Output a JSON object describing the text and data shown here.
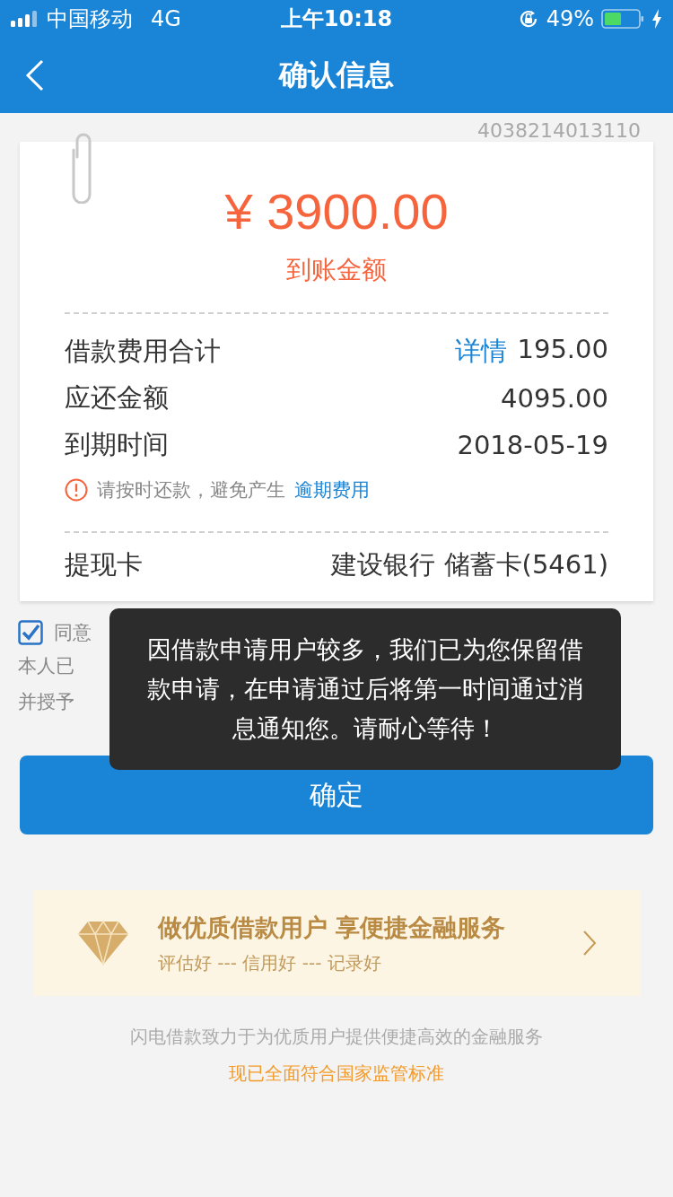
{
  "status_bar": {
    "carrier": "中国移动",
    "network": "4G",
    "time": "上午10:18",
    "battery": "49%"
  },
  "nav": {
    "title": "确认信息"
  },
  "card": {
    "serial": "4038214013110",
    "amount": "¥ 3900.00",
    "amount_label": "到账金额",
    "rows": [
      {
        "label": "借款费用合计",
        "link": "详情",
        "value": "195.00"
      },
      {
        "label": "应还金额",
        "value": "4095.00"
      },
      {
        "label": "到期时间",
        "value": "2018-05-19"
      }
    ],
    "notice": {
      "text": "请按时还款，避免产生",
      "link": "逾期费用"
    },
    "card_row": {
      "label": "提现卡",
      "value": "建设银行 储蓄卡(5461)"
    }
  },
  "agreement": {
    "checked": true,
    "label": "同意",
    "line_2": "本人已",
    "line_3": "并授予"
  },
  "confirm_button": "确定",
  "banner": {
    "title": "做优质借款用户 享便捷金融服务",
    "subtitle": "评估好 --- 信用好 --- 记录好"
  },
  "footer": [
    "闪电借款致力于为优质用户提供便捷高效的金融服务",
    "现已全面符合国家监管标准"
  ],
  "toast": "因借款申请用户较多，我们已为您保留借款申请，在申请通过后将第一时间通过消息通知您。请耐心等待！"
}
